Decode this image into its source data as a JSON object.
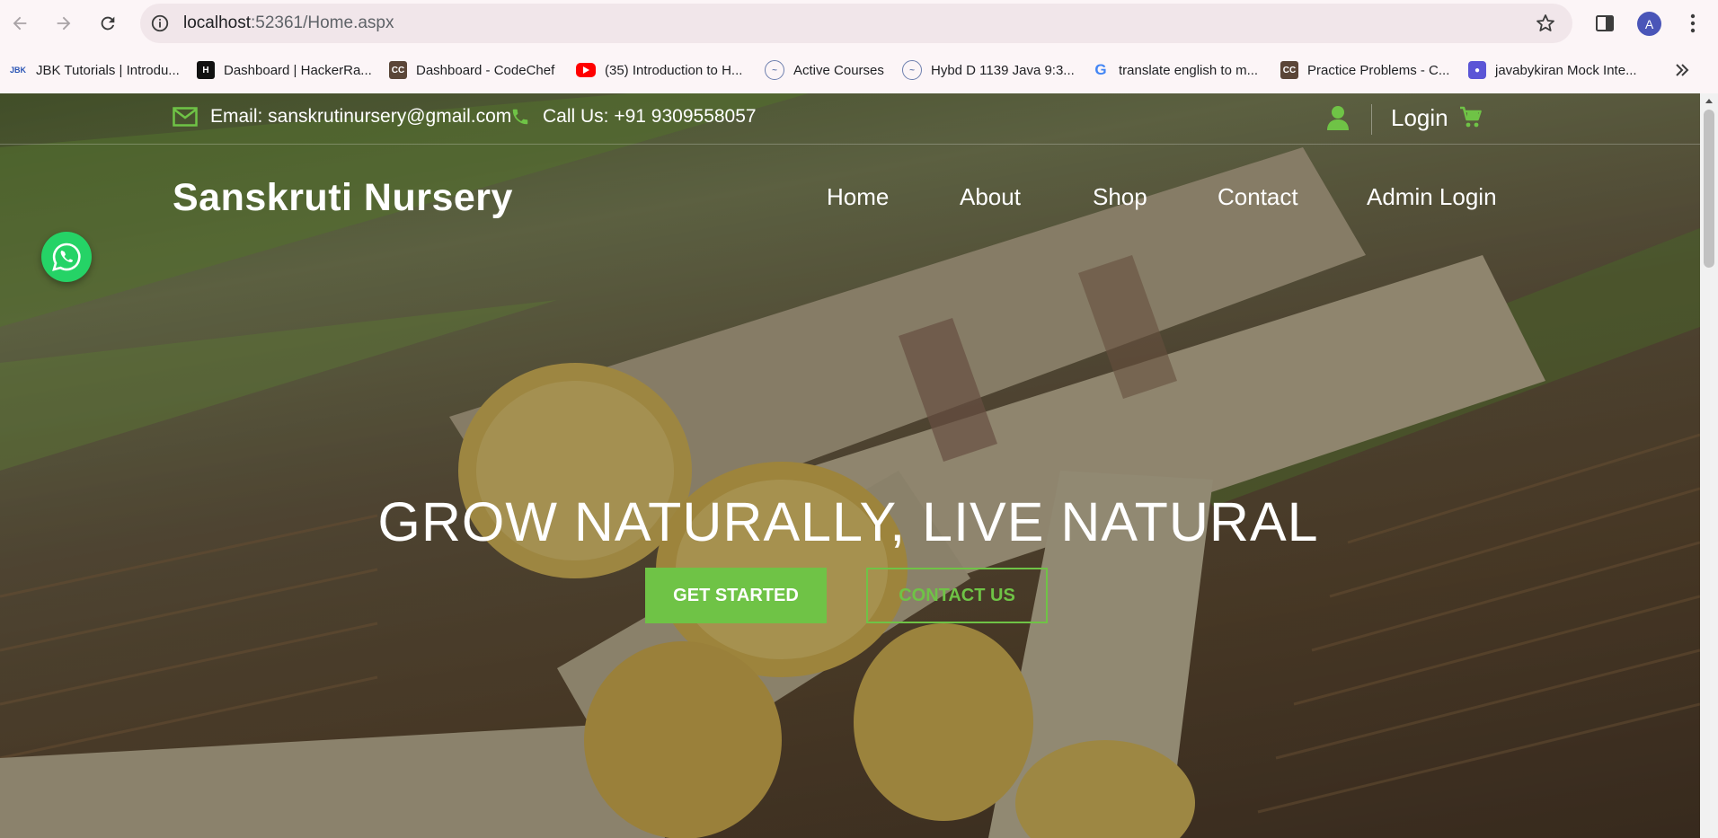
{
  "browser": {
    "url_host": "localhost",
    "url_path": ":52361/Home.aspx",
    "profile_initial": "A"
  },
  "bookmarks": [
    {
      "label": "JBK Tutorials | Introdu...",
      "icon": "jbk-icon"
    },
    {
      "label": "Dashboard | HackerRa...",
      "icon": "hackerrank-icon"
    },
    {
      "label": "Dashboard - CodeChef",
      "icon": "codechef-icon"
    },
    {
      "label": "(35) Introduction to H...",
      "icon": "youtube-icon"
    },
    {
      "label": "Active Courses",
      "icon": "course-icon"
    },
    {
      "label": "Hybd D 1139 Java 9:3...",
      "icon": "course-icon"
    },
    {
      "label": "translate english to m...",
      "icon": "google-icon"
    },
    {
      "label": "Practice Problems - C...",
      "icon": "codechef-icon"
    },
    {
      "label": "javabykiran Mock Inte...",
      "icon": "interview-icon"
    }
  ],
  "topbar": {
    "email": "Email: sanskrutinursery@gmail.com",
    "phone": "Call Us: +91 9309558057",
    "login": "Login"
  },
  "brand": "Sanskruti Nursery",
  "nav": [
    "Home",
    "About",
    "Shop",
    "Contact",
    "Admin Login"
  ],
  "hero": {
    "title": "GROW NATURALLY, LIVE NATURAL",
    "primary_button": "GET STARTED",
    "secondary_button": "CONTACT US"
  },
  "colors": {
    "accent": "#6fc346",
    "whatsapp": "#25d366",
    "avatar": "#4a55b8"
  }
}
